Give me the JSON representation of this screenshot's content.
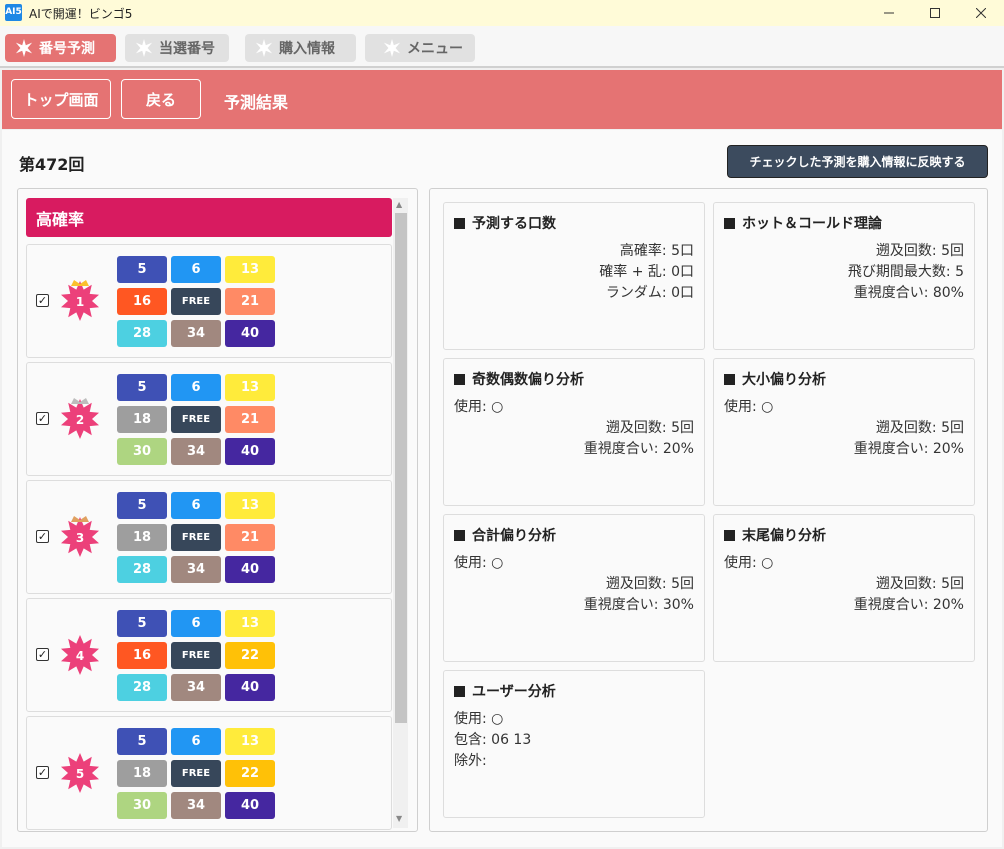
{
  "window": {
    "title": "AIで開運！ビンゴ5",
    "logo_text": "AI5"
  },
  "tabs": [
    {
      "label": "番号予測",
      "active": true
    },
    {
      "label": "当選番号",
      "active": false
    },
    {
      "label": "購入情報",
      "active": false
    },
    {
      "label": "メニュー",
      "active": false
    }
  ],
  "header": {
    "top_label": "トップ画面",
    "back_label": "戻る",
    "title": "予測結果"
  },
  "round": "第472回",
  "reflect_label": "チェックした予測を購入情報に反映する",
  "category": "高確率",
  "predictions": [
    {
      "rank": "1",
      "checked": true,
      "crown": "gold",
      "numbers": [
        "5",
        "6",
        "13",
        "16",
        "FREE",
        "21",
        "28",
        "34",
        "40"
      ]
    },
    {
      "rank": "2",
      "checked": true,
      "crown": "silver",
      "numbers": [
        "5",
        "6",
        "13",
        "18",
        "FREE",
        "21",
        "30",
        "34",
        "40"
      ]
    },
    {
      "rank": "3",
      "checked": true,
      "crown": "bronze",
      "numbers": [
        "5",
        "6",
        "13",
        "18",
        "FREE",
        "21",
        "28",
        "34",
        "40"
      ]
    },
    {
      "rank": "4",
      "checked": true,
      "crown": "none",
      "numbers": [
        "5",
        "6",
        "13",
        "16",
        "FREE",
        "22",
        "28",
        "34",
        "40"
      ]
    },
    {
      "rank": "5",
      "checked": true,
      "crown": "none",
      "numbers": [
        "5",
        "6",
        "13",
        "18",
        "FREE",
        "22",
        "30",
        "34",
        "40"
      ]
    }
  ],
  "colors": {
    "accent": "#e57373",
    "category": "#d81b60",
    "star": "#ec407a",
    "button_dark": "#3c4b5e",
    "ball": {
      "5": "#3f51b5",
      "6": "#2196f3",
      "13": "#ffeb3b",
      "16": "#ff5722",
      "18": "#9e9e9e",
      "FREE": "#37475a",
      "21": "#ff8a65",
      "22": "#ffc107",
      "28": "#4dd0e1",
      "30": "#aed581",
      "34": "#a1887f",
      "40": "#4527a0"
    }
  },
  "settings": {
    "count": {
      "title": "予測する口数",
      "lines": [
        "高確率: 5口",
        "確率 + 乱: 0口",
        "ランダム: 0口"
      ]
    },
    "hotcold": {
      "title": "ホット＆コールド理論",
      "lines": [
        "遡及回数: 5回",
        "飛び期間最大数: 5",
        "重視度合い: 80%"
      ]
    },
    "oddeven": {
      "title": "奇数偶数偏り分析",
      "use": "使用: ○",
      "lines": [
        "遡及回数: 5回",
        "重視度合い: 20%"
      ]
    },
    "bigsmall": {
      "title": "大小偏り分析",
      "use": "使用: ○",
      "lines": [
        "遡及回数: 5回",
        "重視度合い: 20%"
      ]
    },
    "sum": {
      "title": "合計偏り分析",
      "use": "使用: ○",
      "lines": [
        "遡及回数: 5回",
        "重視度合い: 30%"
      ]
    },
    "tail": {
      "title": "末尾偏り分析",
      "use": "使用: ○",
      "lines": [
        "遡及回数: 5回",
        "重視度合い: 20%"
      ]
    },
    "user": {
      "title": "ユーザー分析",
      "use": "使用: ○",
      "include": "包含: 06 13",
      "exclude": "除外:"
    }
  }
}
